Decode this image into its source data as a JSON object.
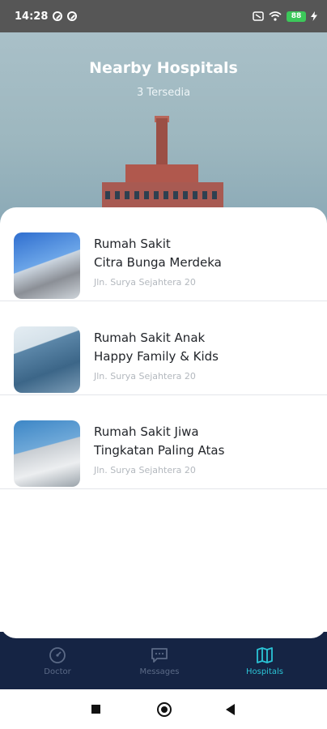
{
  "status_bar": {
    "time": "14:28",
    "battery": "88"
  },
  "header": {
    "title": "Nearby Hospitals",
    "subtitle": "3 Tersedia"
  },
  "hospitals": [
    {
      "name_line1": "Rumah Sakit",
      "name_line2": "Citra Bunga Merdeka",
      "address": "Jln. Surya Sejahtera 20"
    },
    {
      "name_line1": "Rumah Sakit Anak",
      "name_line2": "Happy Family & Kids",
      "address": "Jln. Surya Sejahtera 20"
    },
    {
      "name_line1": "Rumah Sakit Jiwa",
      "name_line2": "Tingkatan Paling Atas",
      "address": "Jln. Surya Sejahtera 20"
    }
  ],
  "bottom_nav": {
    "items": [
      {
        "label": "Doctor",
        "icon": "speedometer-icon",
        "active": false
      },
      {
        "label": "Messages",
        "icon": "chat-icon",
        "active": false
      },
      {
        "label": "Hospitals",
        "icon": "map-icon",
        "active": true
      }
    ]
  },
  "colors": {
    "nav_background": "#152444",
    "nav_active": "#2bc4d6",
    "nav_inactive": "#5b6a86"
  }
}
